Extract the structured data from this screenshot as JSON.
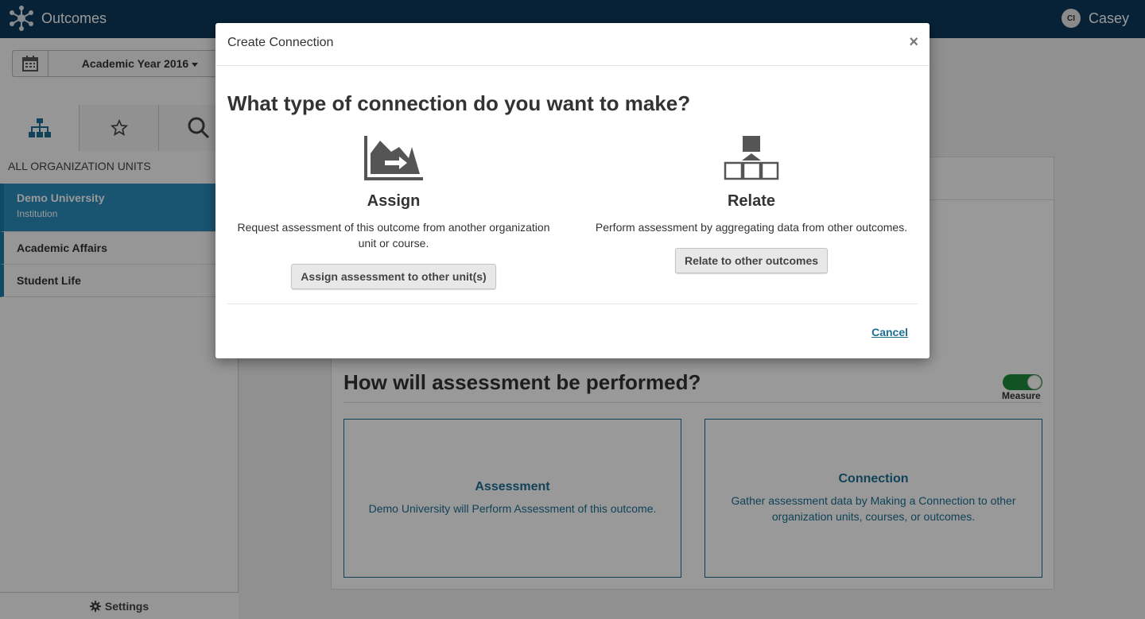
{
  "app": {
    "title": "Outcomes",
    "user_initials": "CI",
    "user_name": "Casey"
  },
  "sidebar": {
    "year_label": "Academic Year 2016",
    "section_label": "ALL ORGANIZATION UNITS",
    "units": [
      {
        "name": "Demo University",
        "sub": "Institution"
      },
      {
        "name": "Academic Affairs"
      },
      {
        "name": "Student Life"
      }
    ],
    "settings_label": "Settings"
  },
  "main": {
    "perform_title": "How will assessment be performed?",
    "toggle_label": "Measure",
    "cards": [
      {
        "title": "Assessment",
        "text": "Demo University will Perform Assessment of this outcome."
      },
      {
        "title": "Connection",
        "text": "Gather assessment data by Making a Connection to other organization units, courses, or outcomes."
      }
    ]
  },
  "modal": {
    "title": "Create Connection",
    "close_glyph": "×",
    "question": "What type of connection do you want to make?",
    "options": [
      {
        "title": "Assign",
        "desc": "Request assessment of this outcome from another organization unit or course.",
        "button": "Assign assessment to other unit(s)",
        "icon": "chart-arrow-icon"
      },
      {
        "title": "Relate",
        "desc": "Perform assessment by aggregating data from other outcomes.",
        "button": "Relate to other outcomes",
        "icon": "hierarchy-icon"
      }
    ],
    "cancel_label": "Cancel"
  },
  "colors": {
    "topbar": "#0d3a5c",
    "accent": "#1b6f93",
    "selected": "#2a8cbc",
    "toggle_on": "#1f8a3c"
  }
}
